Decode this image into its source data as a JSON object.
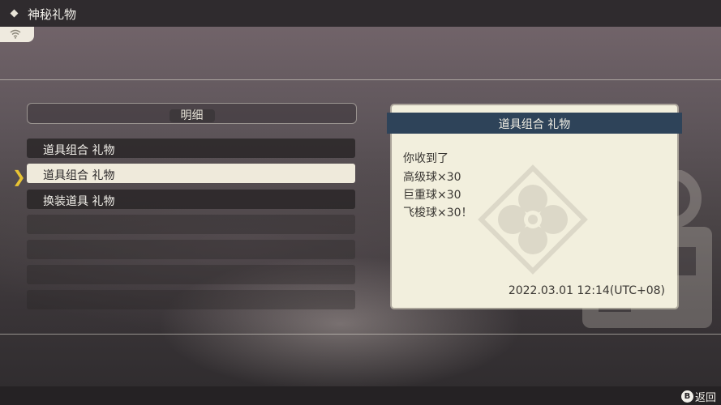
{
  "topbar": {
    "title": "神秘礼物",
    "icon": "diamond-icon"
  },
  "status": {
    "icon": "wifi-icon"
  },
  "list": {
    "header": "明细",
    "items": [
      {
        "label": "道具组合 礼物",
        "selected": false
      },
      {
        "label": "道具组合 礼物",
        "selected": true
      },
      {
        "label": "换装道具 礼物",
        "selected": false
      }
    ]
  },
  "detail": {
    "title": "道具组合 礼物",
    "lines": [
      "你收到了",
      "高级球×30",
      "巨重球×30",
      "飞梭球×30！"
    ],
    "date": "2022.03.01  12:14(UTC+08)"
  },
  "footer": {
    "back_button_icon": "B",
    "back_label": "返回"
  },
  "colors": {
    "topbar": "#2f2b2e",
    "selected_item": "#efeadb",
    "card_header": "#2e4359",
    "card_bg": "#f2efdd",
    "cursor": "#e8c433"
  }
}
